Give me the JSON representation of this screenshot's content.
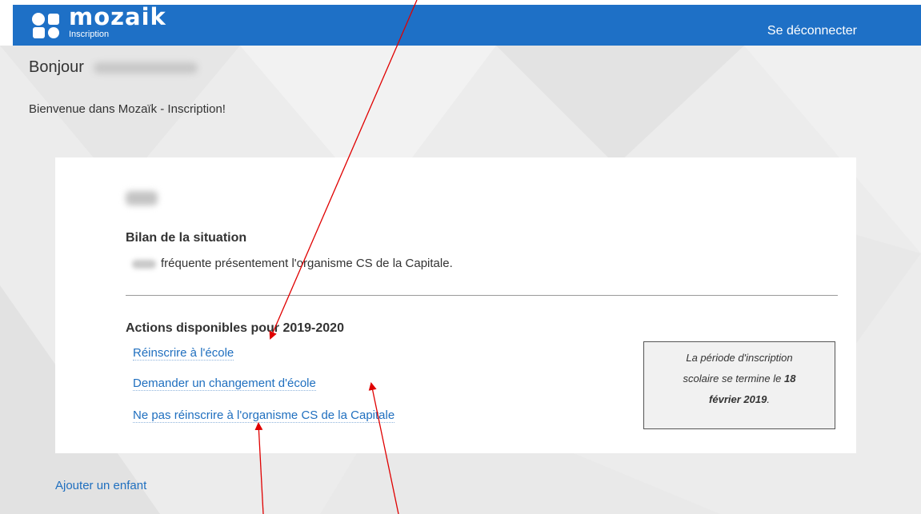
{
  "header": {
    "brand": "mozaik",
    "subtitle": "Inscription",
    "logout_label": "Se déconnecter"
  },
  "greeting": {
    "hello": "Bonjour",
    "welcome": "Bienvenue dans Mozaïk - Inscription!"
  },
  "card": {
    "bilan_title": "Bilan de la situation",
    "bilan_text": "fréquente présentement l'organisme CS de la Capitale.",
    "actions_title": "Actions disponibles pour 2019-2020",
    "actions": [
      {
        "label": "Réinscrire à l'école"
      },
      {
        "label": "Demander un changement d'école"
      },
      {
        "label": "Ne pas réinscrire à l'organisme CS de la Capitale"
      }
    ],
    "notice": {
      "line1": "La période d'inscription",
      "line2_prefix": "scolaire se termine le",
      "line2_day": "18",
      "line3_bold": "février 2019",
      "line3_suffix": "."
    }
  },
  "add_child_label": "Ajouter un enfant",
  "colors": {
    "header_blue": "#1e70c6",
    "link_blue": "#1f6fbf",
    "annotation_red": "#e00000"
  }
}
